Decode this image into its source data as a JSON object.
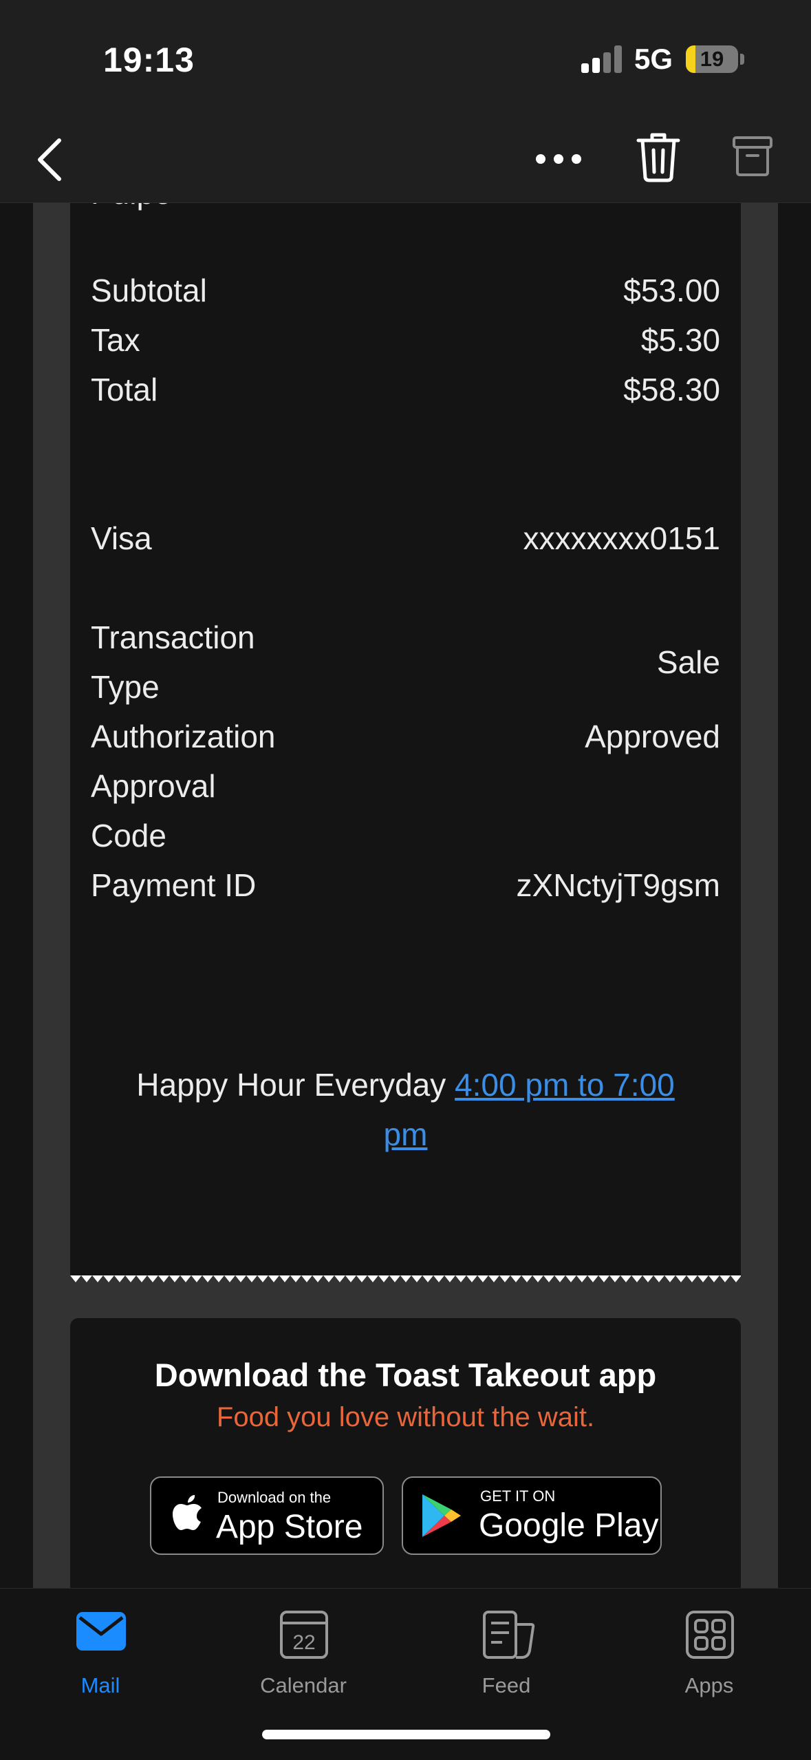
{
  "status_bar": {
    "time": "19:13",
    "network": "5G",
    "battery": "19",
    "battery_level": 0.19
  },
  "nav": {
    "back_icon": "chevron-left-icon",
    "more_icon": "more-horizontal-icon",
    "delete_icon": "trash-icon",
    "archive_icon": "archive-icon"
  },
  "receipt": {
    "cutoff_text": "Pulpo",
    "subtotal_label": "Subtotal",
    "subtotal_value": "$53.00",
    "tax_label": "Tax",
    "tax_value": "$5.30",
    "total_label": "Total",
    "total_value": "$58.30",
    "card_label": "Visa",
    "card_value": "xxxxxxxx0151",
    "transaction_type_label_1": "Transaction",
    "transaction_type_label_2": "Type",
    "transaction_type_value": "Sale",
    "authorization_label": "Authorization",
    "authorization_value": "Approved",
    "approval_code_label_1": "Approval",
    "approval_code_label_2": "Code",
    "payment_id_label": "Payment ID",
    "payment_id_value": "zXNctyjT9gsm",
    "happy_hour_text": "Happy Hour Everyday ",
    "happy_hour_link_1": "4:00 pm to 7:00",
    "happy_hour_link_2": "pm"
  },
  "promo": {
    "title": "Download the Toast Takeout app",
    "subtitle": "Food you love without the wait.",
    "app_store_small": "Download on the",
    "app_store_big": "App Store",
    "google_play_small": "GET IT ON",
    "google_play_big": "Google Play"
  },
  "tabs": [
    {
      "label": "Mail",
      "icon": "mail-icon",
      "active": true
    },
    {
      "label": "Calendar",
      "icon": "calendar-icon",
      "day": "22"
    },
    {
      "label": "Feed",
      "icon": "feed-icon"
    },
    {
      "label": "Apps",
      "icon": "apps-grid-icon"
    }
  ],
  "colors": {
    "accent": "#1a8cff",
    "link": "#3a8ee6",
    "promo_subtitle": "#e8663a"
  }
}
